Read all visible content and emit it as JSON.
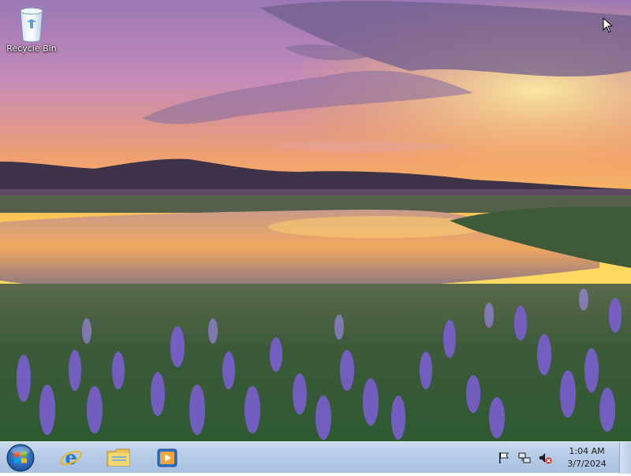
{
  "desktop": {
    "icons": [
      {
        "label": "Recycle Bin",
        "icon": "recycle-bin-icon"
      }
    ]
  },
  "taskbar": {
    "start_button": {
      "icon": "windows-logo-icon"
    },
    "pinned": [
      {
        "name": "Internet Explorer",
        "icon": "internet-explorer-icon"
      },
      {
        "name": "Windows Explorer",
        "icon": "folder-icon"
      },
      {
        "name": "Windows Media Player",
        "icon": "media-player-icon"
      }
    ],
    "tray": {
      "icons": [
        "action-center-flag-icon",
        "network-icon",
        "volume-muted-icon"
      ],
      "time": "1:04 AM",
      "date": "3/7/2024"
    }
  },
  "colors": {
    "taskbar_top": "#c9d9ee",
    "taskbar_bottom": "#a8c0df",
    "sky_top": "#8a6fa8",
    "sky_horizon": "#ffd23a",
    "flowers": "#7a5fd0"
  }
}
